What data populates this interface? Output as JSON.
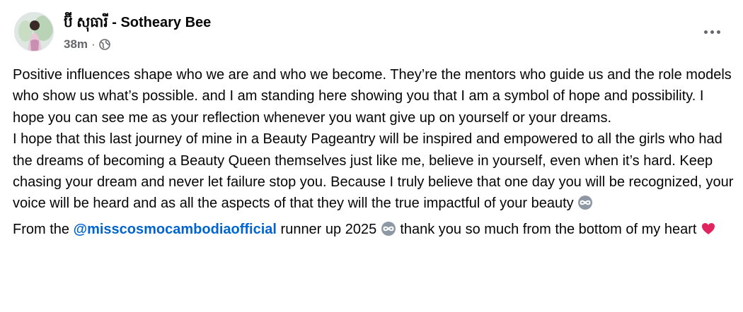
{
  "post": {
    "author": "ប៊ី សុធារី - Sotheary Bee",
    "time": "38m",
    "separator": "·",
    "audience_icon": "globe-icon",
    "more_icon": "more-horizontal-icon",
    "paragraph1": {
      "line1": "Positive influences shape who we are and who we become. They’re the mentors who guide us and the role models who show us what’s possible. and I am standing here showing you that I am a symbol of hope and possibility. I hope you can see me as your reflection whenever you want give up on yourself or your dreams.",
      "line2": "I hope that this last journey of mine in a Beauty Pageantry will be inspired and empowered to all the girls who had the dreams of becoming a Beauty Queen themselves just like me, believe in yourself, even when it’s hard. Keep chasing your dream and never let failure stop you. Because I truly believe that one day you will be recognized, your voice will be heard and as all the aspects of that they will the true impactful of your beauty",
      "emoji": "infinity-emoji"
    },
    "paragraph2": {
      "prefix": "From the",
      "mention": "@misscosmocambodiaofficial",
      "middle": "runner up 2025",
      "emoji1": "infinity-emoji",
      "suffix": "thank you so much from the bottom of my heart",
      "emoji2": "red-heart-emoji"
    },
    "colors": {
      "text": "#050505",
      "secondary": "#65676b",
      "mention": "#0064d1",
      "heart": "#e0245e"
    }
  }
}
